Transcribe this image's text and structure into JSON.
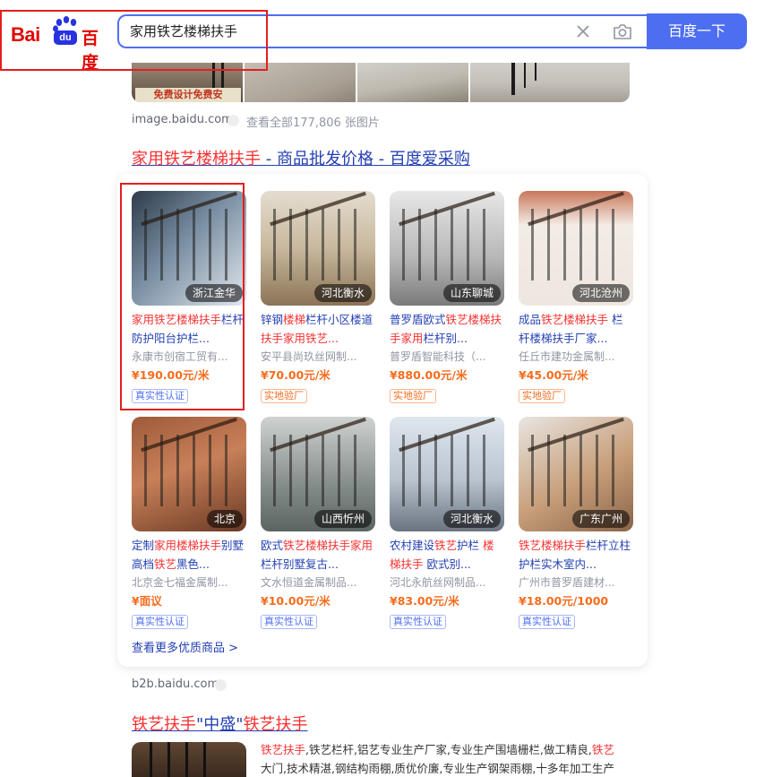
{
  "header": {
    "logo_latin": "Bai",
    "logo_du": "du",
    "logo_cn": "百度",
    "search_value": "家用铁艺楼梯扶手",
    "search_button": "百度一下"
  },
  "image_results": {
    "banner_text": "免费设计免费安",
    "source": "image.baidu.com",
    "count_text": "查看全部177,806 张图片"
  },
  "commerce": {
    "title_em": "家用铁艺楼梯扶手",
    "title_rest": " - 商品批发价格 - 百度爱采购",
    "more_link": "查看更多优质商品 >",
    "source": "b2b.baidu.com",
    "products": [
      {
        "loc": "浙江金华",
        "title": [
          "家用铁艺楼梯扶手",
          "栏杆防护阳台护栏..."
        ],
        "title_em": [
          true,
          false
        ],
        "seller": "永康市创宿工贸有...",
        "price": "¥190.00元/米",
        "badge": "真实性认证",
        "badge_type": "blue"
      },
      {
        "loc": "河北衡水",
        "title": [
          "锌钢",
          "楼梯",
          "栏杆小区楼道",
          "扶手家用铁艺..."
        ],
        "title_em": [
          false,
          true,
          false,
          true
        ],
        "seller": "安平县尚玖丝网制...",
        "price": "¥70.00元/米",
        "badge": "实地验厂",
        "badge_type": "orange"
      },
      {
        "loc": "山东聊城",
        "title": [
          "普罗盾欧式",
          "铁艺楼梯",
          "扶手家用",
          "栏杆别..."
        ],
        "title_em": [
          false,
          true,
          true,
          false
        ],
        "seller": "普罗盾智能科技（...",
        "price": "¥880.00元/米",
        "badge": "实地验厂",
        "badge_type": "orange"
      },
      {
        "loc": "河北沧州",
        "title": [
          "成品",
          "铁艺楼梯扶手",
          " 栏杆楼梯扶手厂家..."
        ],
        "title_em": [
          false,
          true,
          false
        ],
        "seller": "任丘市建功金属制...",
        "price": "¥45.00元/米",
        "badge": "实地验厂",
        "badge_type": "orange"
      },
      {
        "loc": "北京",
        "title": [
          "定制",
          "家用楼梯扶手",
          "别墅高档",
          "铁艺",
          "黑色..."
        ],
        "title_em": [
          false,
          true,
          false,
          true,
          false
        ],
        "seller": "北京金七福金属制...",
        "price": "¥面议",
        "badge": "真实性认证",
        "badge_type": "blue"
      },
      {
        "loc": "山西忻州",
        "title": [
          "欧式",
          "铁艺楼梯扶手家用",
          "栏杆别墅复古..."
        ],
        "title_em": [
          false,
          true,
          false
        ],
        "seller": "文水恒道金属制品...",
        "price": "¥10.00元/米",
        "badge": "真实性认证",
        "badge_type": "blue"
      },
      {
        "loc": "河北衡水",
        "title": [
          "农村建设",
          "铁艺",
          "护栏 ",
          "楼梯扶手",
          " 欧式别..."
        ],
        "title_em": [
          false,
          true,
          false,
          true,
          false
        ],
        "seller": "河北永航丝网制品...",
        "price": "¥83.00元/米",
        "badge": "真实性认证",
        "badge_type": "blue"
      },
      {
        "loc": "广东广州",
        "title": [
          "铁艺楼梯扶手",
          "栏杆立柱护栏实木室内..."
        ],
        "title_em": [
          true,
          false
        ],
        "seller": "广州市普罗盾建材...",
        "price": "¥18.00元/1000",
        "badge": "真实性认证",
        "badge_type": "blue"
      }
    ]
  },
  "result3": {
    "title_em1": "铁艺扶手",
    "title_mid": "\"中盛\"",
    "title_em2": "铁艺扶手",
    "snippet_line1_em": "铁艺扶手",
    "snippet_line1": ",铁艺栏杆,铝艺专业生产厂家,专业生产围墙栅栏,做工精良,",
    "snippet_line1_em2": "铁艺",
    "snippet_line2": "大门,技术精湛,钢结构雨棚,质优价廉,专业生产钢架雨棚,十多年加工生产"
  },
  "colors": {
    "accent": "#4e6ef2",
    "link": "#2440b3",
    "highlight": "#f73131",
    "price": "#f56c1d",
    "annotation": "#e41e1e"
  }
}
